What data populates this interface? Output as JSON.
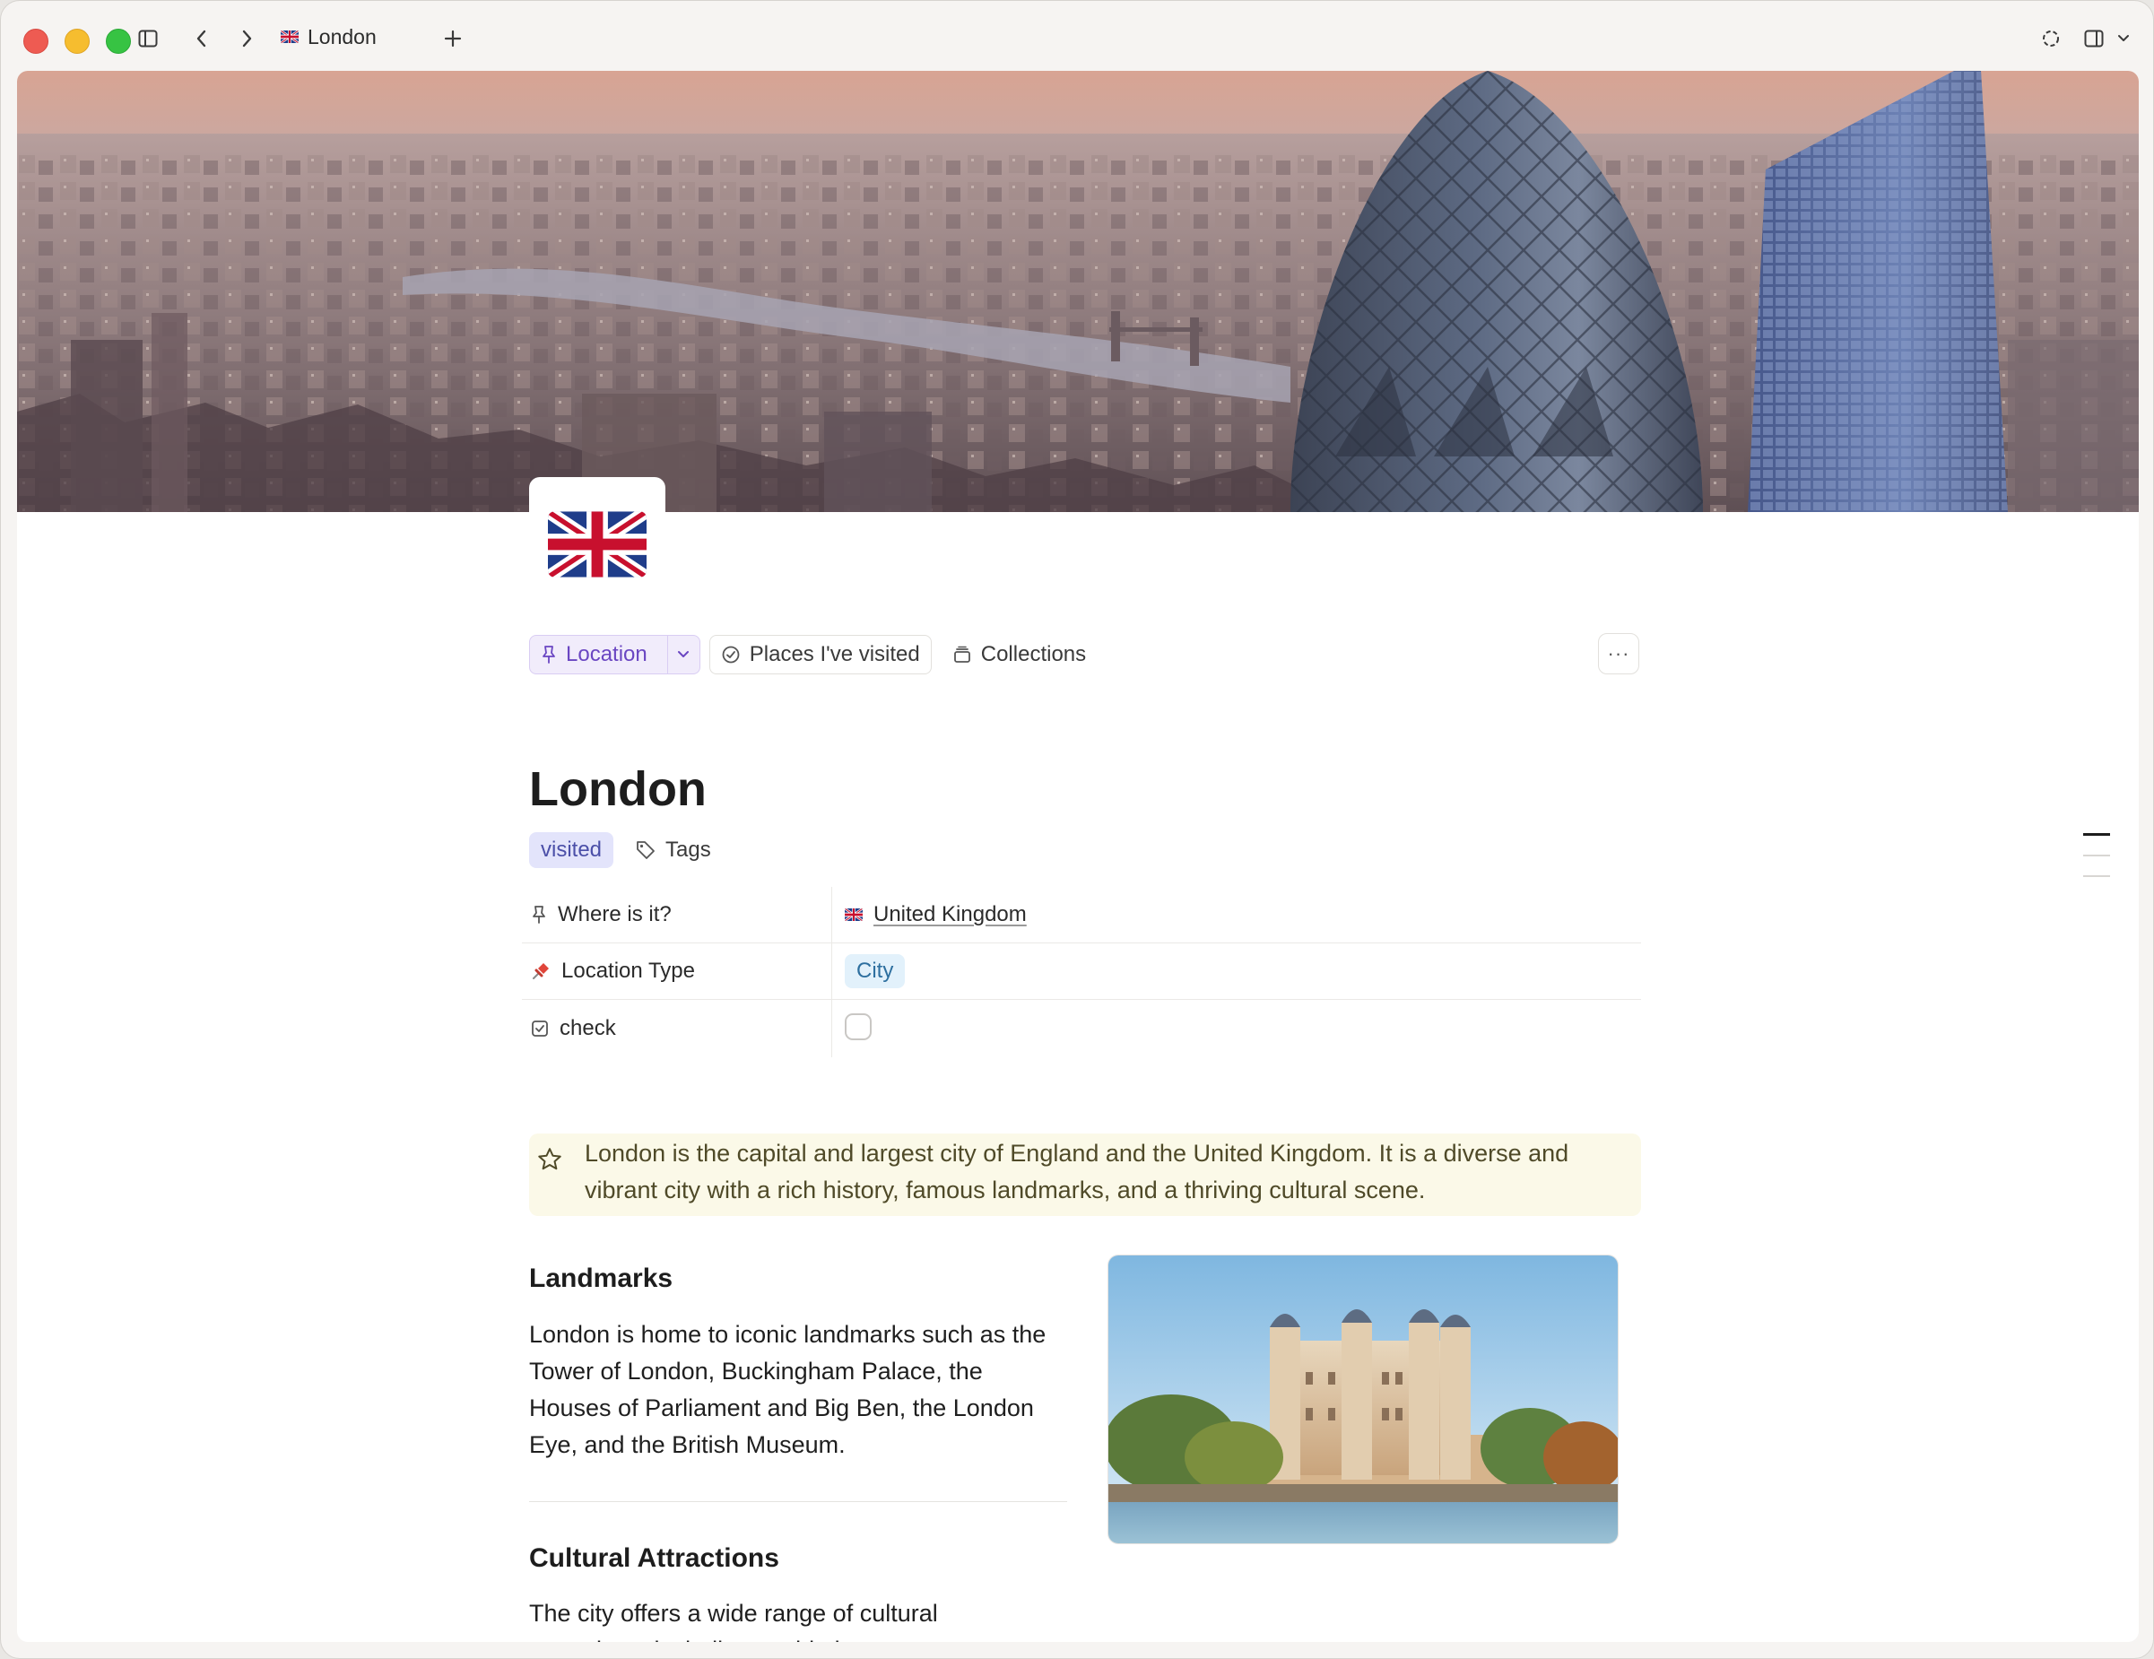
{
  "window": {
    "tab_title": "London"
  },
  "breadcrumbs": {
    "location_label": "Location",
    "places_label": "Places I've visited",
    "collections_label": "Collections",
    "more_label": "···"
  },
  "page": {
    "title": "London",
    "tag_visited": "visited",
    "tags_label": "Tags"
  },
  "properties": [
    {
      "key": "Where is it?",
      "value": "United Kingdom"
    },
    {
      "key": "Location Type",
      "value": "City"
    },
    {
      "key": "check",
      "value": ""
    }
  ],
  "callout": {
    "text": "London is the capital and largest city of England and the United Kingdom. It is a diverse and vibrant city with a rich history, famous landmarks, and a thriving cultural scene."
  },
  "sections": {
    "landmarks_heading": "Landmarks",
    "landmarks_text": "London is home to iconic landmarks such as the Tower of London, Buckingham Palace, the Houses of Parliament and Big Ben, the London Eye, and the British Museum.",
    "culture_heading": "Cultural Attractions",
    "culture_text": "The city offers a wide range of cultural attractions, including world-class museums (such as the Tate Modern and the Victoria"
  },
  "colors": {
    "accent_purple": "#6a46c2",
    "visited_tag": "#e3e4fb",
    "callout_bg": "#fbf9e8",
    "city_badge": "#e2f1fb"
  }
}
